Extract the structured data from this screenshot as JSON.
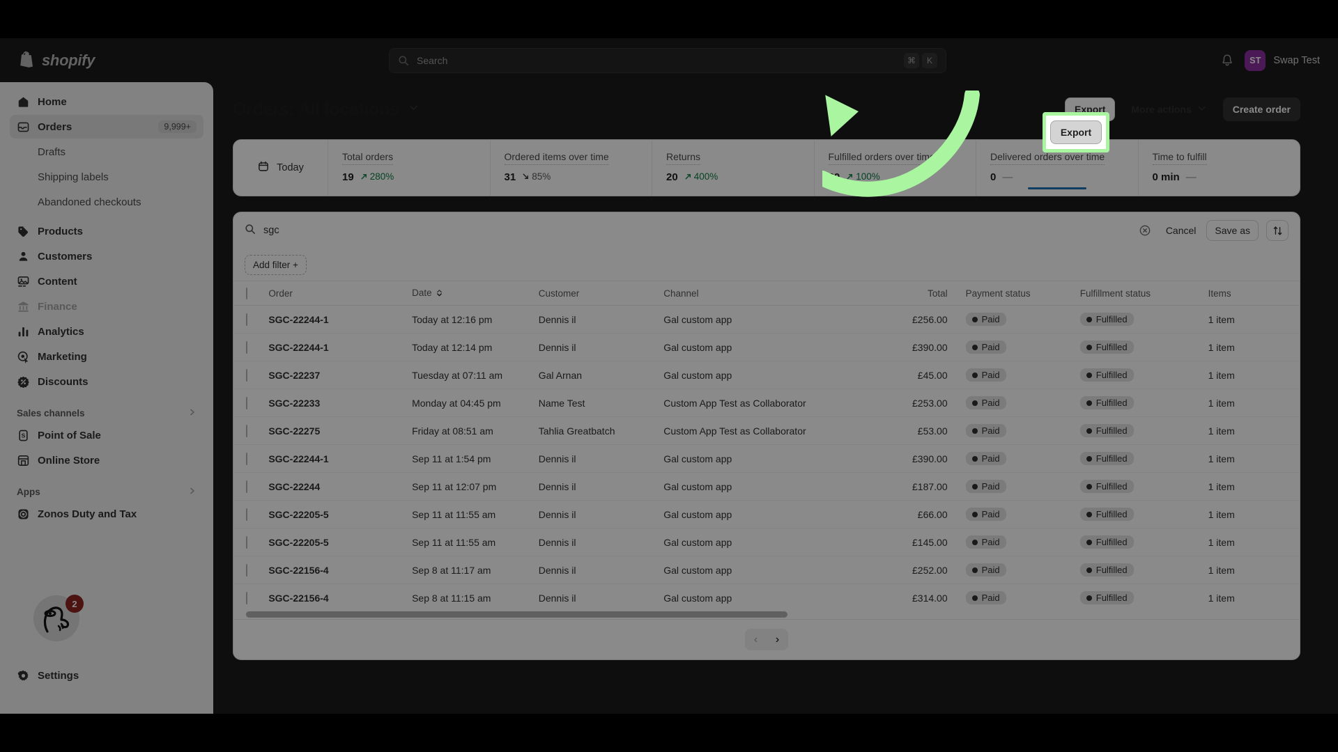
{
  "topbar": {
    "brand": "shopify",
    "search": {
      "placeholder": "Search",
      "kbd_mod": "⌘",
      "kbd_key": "K"
    },
    "user": {
      "initials": "ST",
      "name": "Swap Test",
      "avatar_color": "#8b2f9e"
    }
  },
  "sidebar": {
    "items": [
      {
        "label": "Home",
        "icon": "home-icon",
        "badge": ""
      },
      {
        "label": "Orders",
        "icon": "orders-icon",
        "badge": "9,999+"
      },
      {
        "label": "Drafts",
        "icon": "",
        "badge": ""
      },
      {
        "label": "Shipping labels",
        "icon": "",
        "badge": ""
      },
      {
        "label": "Abandoned checkouts",
        "icon": "",
        "badge": ""
      },
      {
        "label": "Products",
        "icon": "products-icon",
        "badge": ""
      },
      {
        "label": "Customers",
        "icon": "customers-icon",
        "badge": ""
      },
      {
        "label": "Content",
        "icon": "content-icon",
        "badge": ""
      },
      {
        "label": "Finance",
        "icon": "finance-icon",
        "badge": ""
      },
      {
        "label": "Analytics",
        "icon": "analytics-icon",
        "badge": ""
      },
      {
        "label": "Marketing",
        "icon": "marketing-icon",
        "badge": ""
      },
      {
        "label": "Discounts",
        "icon": "discounts-icon",
        "badge": ""
      }
    ],
    "sales_channels_header": "Sales channels",
    "sales_channels": [
      {
        "label": "Point of Sale",
        "icon": "pos-icon"
      },
      {
        "label": "Online Store",
        "icon": "online-store-icon"
      }
    ],
    "apps_header": "Apps",
    "apps": [
      {
        "label": "Zonos Duty and Tax",
        "icon": "zonos-icon"
      }
    ],
    "avatar_badge": "2",
    "settings_label": "Settings"
  },
  "page": {
    "title_prefix": "Orders:",
    "title_location": "All locations",
    "actions": {
      "export": "Export",
      "more_actions": "More actions",
      "create_order": "Create order"
    }
  },
  "metrics": {
    "range_label": "Today",
    "items": [
      {
        "label": "Total orders",
        "value": "19",
        "delta": "280%",
        "trend": "up",
        "active": false
      },
      {
        "label": "Ordered items over time",
        "value": "31",
        "delta": "85%",
        "trend": "down",
        "active": false
      },
      {
        "label": "Returns",
        "value": "20",
        "delta": "400%",
        "trend": "up",
        "active": false
      },
      {
        "label": "Fulfilled orders over time",
        "value": "20",
        "delta": "100%",
        "trend": "up",
        "active": false
      },
      {
        "label": "Delivered orders over time",
        "value": "0",
        "delta": "—",
        "trend": "flat",
        "active": true
      },
      {
        "label": "Time to fulfill",
        "value": "0 min",
        "delta": "—",
        "trend": "flat",
        "active": false
      }
    ],
    "active_underline_color": "#1f6fb2"
  },
  "filters": {
    "search_value": "sgc",
    "clear_label": "clear-search",
    "cancel": "Cancel",
    "save_as": "Save as",
    "sort_label": "sort",
    "add_filter": "Add filter +"
  },
  "table": {
    "columns": [
      "Order",
      "Date",
      "Customer",
      "Channel",
      "Total",
      "Payment status",
      "Fulfillment status",
      "Items"
    ],
    "sorted_column": "Date",
    "rows": [
      {
        "order": "SGC-22244-1",
        "date": "Today at 12:16 pm",
        "customer": "Dennis il",
        "channel": "Gal custom app",
        "total": "£256.00",
        "payment": "Paid",
        "fulfillment": "Fulfilled",
        "items": "1 item"
      },
      {
        "order": "SGC-22244-1",
        "date": "Today at 12:14 pm",
        "customer": "Dennis il",
        "channel": "Gal custom app",
        "total": "£390.00",
        "payment": "Paid",
        "fulfillment": "Fulfilled",
        "items": "1 item"
      },
      {
        "order": "SGC-22237",
        "date": "Tuesday at 07:11 am",
        "customer": "Gal Arnan",
        "channel": "Gal custom app",
        "total": "£45.00",
        "payment": "Paid",
        "fulfillment": "Fulfilled",
        "items": "1 item"
      },
      {
        "order": "SGC-22233",
        "date": "Monday at 04:45 pm",
        "customer": "Name Test",
        "channel": "Custom App Test as Collaborator",
        "total": "£253.00",
        "payment": "Paid",
        "fulfillment": "Fulfilled",
        "items": "1 item"
      },
      {
        "order": "SGC-22275",
        "date": "Friday at 08:51 am",
        "customer": "Tahlia Greatbatch",
        "channel": "Custom App Test as Collaborator",
        "total": "£53.00",
        "payment": "Paid",
        "fulfillment": "Fulfilled",
        "items": "1 item"
      },
      {
        "order": "SGC-22244-1",
        "date": "Sep 11 at 1:54 pm",
        "customer": "Dennis il",
        "channel": "Gal custom app",
        "total": "£390.00",
        "payment": "Paid",
        "fulfillment": "Fulfilled",
        "items": "1 item"
      },
      {
        "order": "SGC-22244",
        "date": "Sep 11 at 12:07 pm",
        "customer": "Dennis il",
        "channel": "Gal custom app",
        "total": "£187.00",
        "payment": "Paid",
        "fulfillment": "Fulfilled",
        "items": "1 item"
      },
      {
        "order": "SGC-22205-5",
        "date": "Sep 11 at 11:55 am",
        "customer": "Dennis il",
        "channel": "Gal custom app",
        "total": "£66.00",
        "payment": "Paid",
        "fulfillment": "Fulfilled",
        "items": "1 item"
      },
      {
        "order": "SGC-22205-5",
        "date": "Sep 11 at 11:55 am",
        "customer": "Dennis il",
        "channel": "Gal custom app",
        "total": "£145.00",
        "payment": "Paid",
        "fulfillment": "Fulfilled",
        "items": "1 item"
      },
      {
        "order": "SGC-22156-4",
        "date": "Sep 8 at 11:17 am",
        "customer": "Dennis il",
        "channel": "Gal custom app",
        "total": "£252.00",
        "payment": "Paid",
        "fulfillment": "Fulfilled",
        "items": "1 item"
      },
      {
        "order": "SGC-22156-4",
        "date": "Sep 8 at 11:15 am",
        "customer": "Dennis il",
        "channel": "Gal custom app",
        "total": "£314.00",
        "payment": "Paid",
        "fulfillment": "Fulfilled",
        "items": "1 item"
      }
    ]
  },
  "pagination": {
    "prev": "‹",
    "next": "›"
  },
  "annotation": {
    "highlight_target": "Export",
    "highlight_color": "#a9f5a0",
    "arrow_color": "#a9f5a0"
  }
}
